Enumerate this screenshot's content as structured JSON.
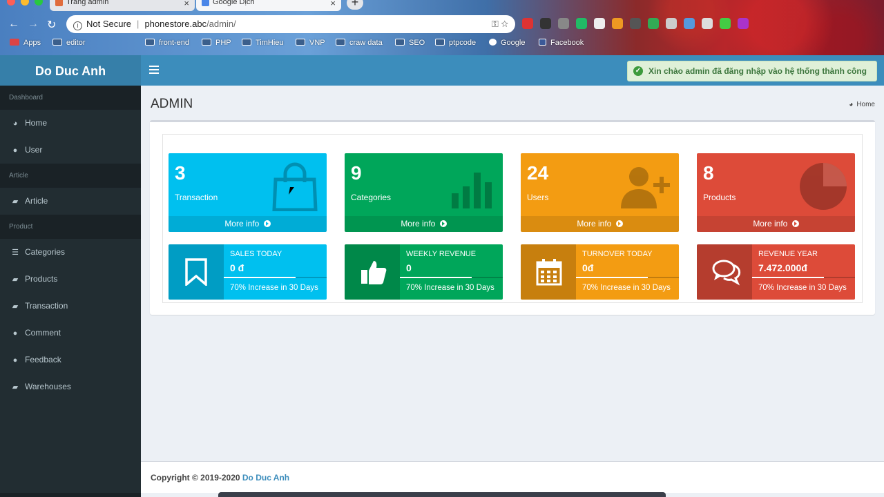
{
  "browser": {
    "tabs": [
      {
        "label": "Trang admin"
      },
      {
        "label": "Google Dịch"
      }
    ],
    "new_tab": "+",
    "address": {
      "security": "Not Secure",
      "host": "phonestore.abc",
      "path": "/admin/"
    },
    "bookmarks": [
      "Apps",
      "editor",
      "front-end",
      "PHP",
      "TimHieu",
      "VNP",
      "craw data",
      "SEO",
      "ptpcode",
      "Google",
      "Facebook"
    ]
  },
  "brand": {
    "name": "Do Duc Anh"
  },
  "notification": {
    "text": "Xin chào admin đã đăng nhập vào hệ thống thành công"
  },
  "sidebar": {
    "sections": [
      {
        "header": "Dashboard",
        "items": [
          {
            "label": "Home",
            "icon": "dashboard-icon"
          },
          {
            "label": "User",
            "icon": "user-icon"
          }
        ]
      },
      {
        "header": "Article",
        "items": [
          {
            "label": "Article",
            "icon": "book-icon"
          }
        ]
      },
      {
        "header": "Product",
        "items": [
          {
            "label": "Categories",
            "icon": "database-icon"
          },
          {
            "label": "Products",
            "icon": "book-icon"
          },
          {
            "label": "Transaction",
            "icon": "book-icon"
          },
          {
            "label": "Comment",
            "icon": "comment-icon"
          },
          {
            "label": "Feedback",
            "icon": "comment-icon"
          },
          {
            "label": "Warehouses",
            "icon": "book-icon"
          }
        ]
      }
    ]
  },
  "page": {
    "title": "ADMIN",
    "breadcrumb": "Home"
  },
  "stats": [
    {
      "number": "3",
      "label": "Transaction",
      "more": "More info",
      "color": "#00c0ef",
      "icon": "shopping-bag-icon"
    },
    {
      "number": "9",
      "label": "Categories",
      "more": "More info",
      "color": "#00a65a",
      "icon": "bar-chart-icon"
    },
    {
      "number": "24",
      "label": "Users",
      "more": "More info",
      "color": "#f39c12",
      "icon": "user-plus-icon"
    },
    {
      "number": "8",
      "label": "Products",
      "more": "More info",
      "color": "#dd4b39",
      "icon": "pie-chart-icon"
    }
  ],
  "infos": [
    {
      "title": "SALES TODAY",
      "value": "0 đ",
      "progress": 0.7,
      "desc": "70% Increase in 30 Days",
      "color": "#00c0ef",
      "icon": "bookmark-icon"
    },
    {
      "title": "WEEKLY REVENUE",
      "value": "0",
      "progress": 0.7,
      "desc": "70% Increase in 30 Days",
      "color": "#00a65a",
      "icon": "thumbs-up-icon"
    },
    {
      "title": "TURNOVER TODAY",
      "value": "0đ",
      "progress": 0.7,
      "desc": "70% Increase in 30 Days",
      "color": "#f39c12",
      "icon": "calendar-icon"
    },
    {
      "title": "REVENUE YEAR",
      "value": "7.472.000đ",
      "progress": 0.7,
      "desc": "70% Increase in 30 Days",
      "color": "#dd4b39",
      "icon": "comments-icon"
    }
  ],
  "footer": {
    "copyright": "Copyright © 2019-2020",
    "author": "Do Duc Anh"
  }
}
